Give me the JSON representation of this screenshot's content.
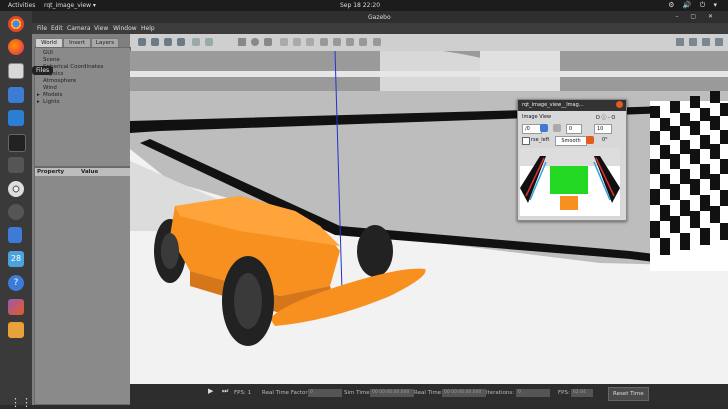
{
  "topbar": {
    "activities": "Activities",
    "app": "rqt_image_view ▾",
    "clock": "Sep 18  22:20",
    "tray": "⚙ 🔊 ⏻ ▾"
  },
  "tooltip": "Files",
  "window": {
    "title": "Gazebo",
    "controls": "– ▢ ✕"
  },
  "menu": [
    "File",
    "Edit",
    "Camera",
    "View",
    "Window",
    "Help"
  ],
  "left_panel": {
    "tabs": [
      "World",
      "Insert",
      "Layers"
    ],
    "tree": [
      "GUI",
      "Scene",
      "Spherical Coordinates",
      "Physics",
      "Atmosphere",
      "Wind",
      "Models",
      "Lights"
    ],
    "props_headers": [
      "Property",
      "Value"
    ]
  },
  "status": {
    "fps": "FPS: 1",
    "rtf_label": "Real Time Factor:",
    "rtf": "0",
    "sim_label": "Sim Time:",
    "sim": "00 00:00:00.000",
    "real_label": "Real Time:",
    "real": "00 00:00:00.000",
    "iter_label": "Iterations:",
    "iter": "0",
    "fps2_label": "FPS:",
    "fps2": "62.04",
    "reset": "Reset Time"
  },
  "rqt": {
    "title": "rqt_image_view__Imag...",
    "plugin": "Image View",
    "topic": "/0",
    "num1": "0",
    "num2": "10",
    "checkbox_label": "rse_left",
    "smooth": "Smooth",
    "rot": "0°",
    "pluginctl": "D ⓘ -  O"
  },
  "colors": {
    "car": "#f7901e",
    "accent": "#e25c1e",
    "viewport_bg": "#bdbdbd"
  }
}
